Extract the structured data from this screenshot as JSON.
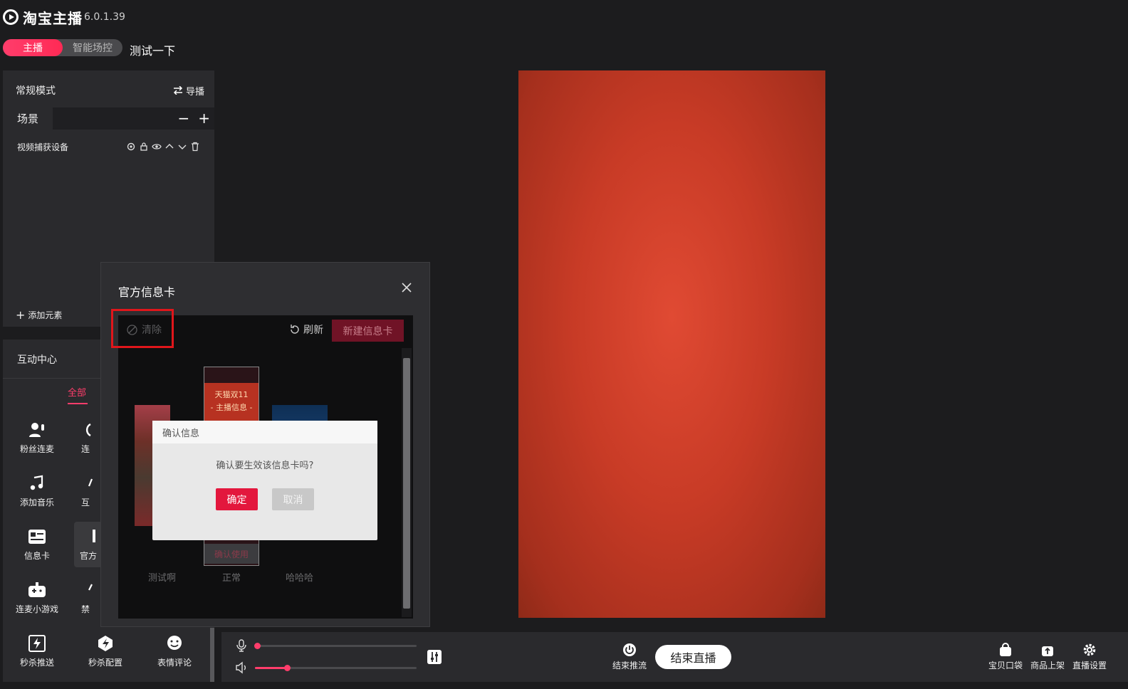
{
  "app": {
    "title": "淘宝主播",
    "version": "6.0.1.39"
  },
  "mode_toggle": {
    "active": "主播",
    "inactive": "智能场控"
  },
  "room_title": "测试一下",
  "scene_panel": {
    "mode_label": "常规模式",
    "switch_label": "导播",
    "scene_tab": "场景",
    "source_name": "视频捕获设备",
    "add_element": "添加元素"
  },
  "interaction": {
    "title": "互动中心",
    "tab_all": "全部",
    "tools": [
      {
        "label": "粉丝连麦",
        "icon": "fans-mic-icon"
      },
      {
        "label": "连",
        "icon": "connect-icon"
      },
      {
        "label": "添加音乐",
        "icon": "music-icon"
      },
      {
        "label": "互",
        "icon": "interact-icon"
      },
      {
        "label": "信息卡",
        "icon": "info-card-icon"
      },
      {
        "label": "官方",
        "icon": "official-card-icon"
      },
      {
        "label": "连麦小游戏",
        "icon": "game-icon"
      },
      {
        "label": "禁",
        "icon": "ban-icon"
      },
      {
        "label": "秒杀推送",
        "icon": "flash-push-icon"
      },
      {
        "label": "秒杀配置",
        "icon": "flash-config-icon"
      },
      {
        "label": "表情评论",
        "icon": "emoji-comment-icon"
      }
    ]
  },
  "audio": {
    "mic_level": 0.0,
    "speaker_level": 0.2
  },
  "bottom": {
    "end_push": "结束推流",
    "end_live": "结束直播",
    "right_tools": [
      "宝贝口袋",
      "商品上架",
      "直播设置"
    ]
  },
  "dialog": {
    "title": "官方信息卡",
    "clear": "清除",
    "refresh": "刷新",
    "new_card": "新建信息卡",
    "card_mid_line1": "天猫双11",
    "card_mid_line2": "- 主播信息 -",
    "card_confirm": "确认使用",
    "card_names": [
      "测试啊",
      "正常",
      "哈哈哈"
    ]
  },
  "confirm": {
    "title": "确认信息",
    "message": "确认要生效该信息卡吗?",
    "ok": "确定",
    "cancel": "取消"
  },
  "colors": {
    "accent": "#ff3d6b",
    "highlight": "#e0161b",
    "preview": "#c83b26"
  }
}
